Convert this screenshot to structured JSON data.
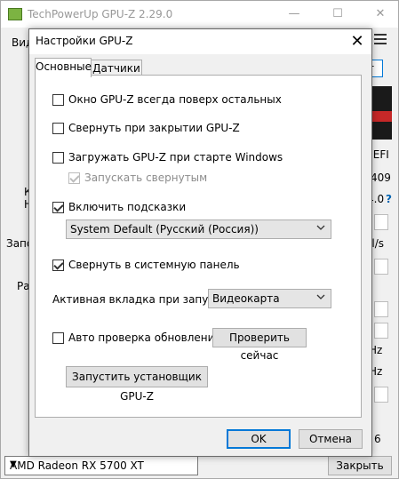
{
  "main_window": {
    "title": "TechPowerUp GPU-Z 2.29.0",
    "minimize_glyph": "—",
    "maximize_glyph": "☐",
    "close_glyph": "✕",
    "tab_fragment": "Вид",
    "lookup_fragment": "т",
    "uefi_label": "UEFI",
    "bios_fragment": "409",
    "version_fragment": "4.0",
    "help_glyph": "?",
    "left_frag_1": "К",
    "left_frag_2": "Н",
    "left_frag_3": "Запо",
    "left_frag_4": "Ра",
    "unit_1": "el/s",
    "unit_2": "s",
    "unit_3": "Hz",
    "unit_4": "Hz",
    "count_fragment": "6",
    "gpu_select_value": "AMD Radeon RX 5700 XT",
    "close_button": "Закрыть"
  },
  "dialog": {
    "title": "Настройки GPU-Z",
    "close_glyph": "✕",
    "tabs": [
      "Основные",
      "Датчики"
    ],
    "always_on_top": {
      "label": "Окно GPU-Z всегда поверх остальных",
      "checked": false
    },
    "minimize_on_close": {
      "label": "Свернуть при закрытии GPU-Z",
      "checked": false
    },
    "load_on_startup": {
      "label": "Загружать GPU-Z при старте Windows",
      "checked": false
    },
    "start_minimized": {
      "label": "Запускать свернутым",
      "checked": true,
      "disabled": true
    },
    "enable_tooltips": {
      "label": "Включить подсказки",
      "checked": true
    },
    "language_select": "System Default (Русский (Россия))",
    "minimize_to_tray": {
      "label": "Свернуть в системную панель",
      "checked": true
    },
    "startup_tab_label": "Активная вкладка при запуске:",
    "startup_tab_value": "Видеокарта",
    "auto_update": {
      "label": "Авто проверка обновлений",
      "checked": false
    },
    "check_now_button": "Проверить сейчас",
    "run_installer_button": "Запустить установщик GPU-Z",
    "ok_button": "OK",
    "cancel_button": "Отмена"
  },
  "colors": {
    "accent": "#0078d7",
    "app_icon": "#7cb342",
    "amd_red": "#c62828"
  }
}
